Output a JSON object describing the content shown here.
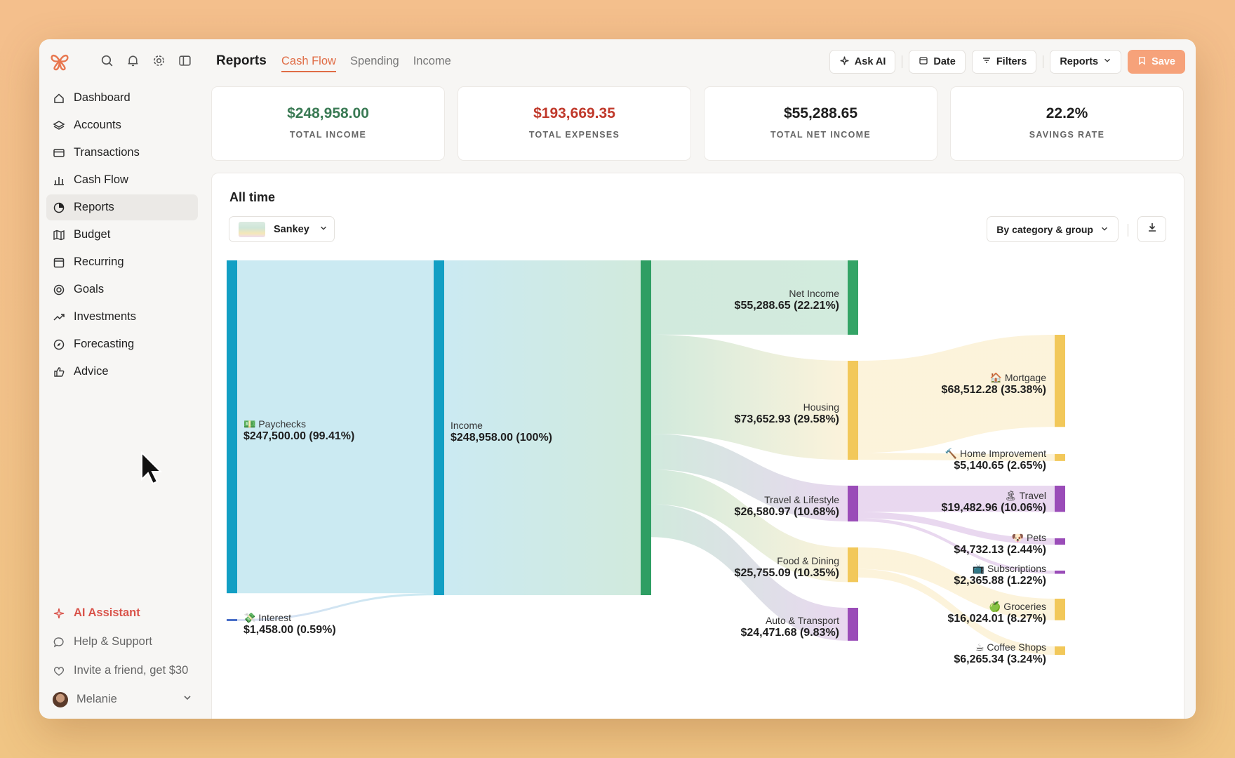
{
  "sidebar": {
    "nav": [
      {
        "label": "Dashboard",
        "icon": "home-icon"
      },
      {
        "label": "Accounts",
        "icon": "layers-icon"
      },
      {
        "label": "Transactions",
        "icon": "card-icon"
      },
      {
        "label": "Cash Flow",
        "icon": "bar-chart-icon"
      },
      {
        "label": "Reports",
        "icon": "pie-chart-icon",
        "active": true
      },
      {
        "label": "Budget",
        "icon": "map-icon"
      },
      {
        "label": "Recurring",
        "icon": "calendar-icon"
      },
      {
        "label": "Goals",
        "icon": "target-icon"
      },
      {
        "label": "Investments",
        "icon": "trend-icon"
      },
      {
        "label": "Forecasting",
        "icon": "compass-icon"
      },
      {
        "label": "Advice",
        "icon": "thumbs-up-icon"
      }
    ],
    "ai_assistant": "AI Assistant",
    "help": "Help & Support",
    "invite": "Invite a friend, get $30",
    "user": "Melanie"
  },
  "header": {
    "title": "Reports",
    "tabs": [
      "Cash Flow",
      "Spending",
      "Income"
    ],
    "active_tab": "Cash Flow",
    "ask_ai": "Ask AI",
    "date": "Date",
    "filters": "Filters",
    "reports": "Reports",
    "save": "Save"
  },
  "stats": [
    {
      "value": "$248,958.00",
      "label": "TOTAL INCOME",
      "color": "#3a7a54"
    },
    {
      "value": "$193,669.35",
      "label": "TOTAL EXPENSES",
      "color": "#c0392b"
    },
    {
      "value": "$55,288.65",
      "label": "TOTAL NET INCOME",
      "color": "#1e1e1e"
    },
    {
      "value": "22.2%",
      "label": "SAVINGS RATE",
      "color": "#1e1e1e"
    }
  ],
  "card": {
    "title": "All time",
    "chart_type_select": "Sankey",
    "group_select": "By category & group"
  },
  "chart_data": {
    "type": "sankey",
    "nodes": [
      {
        "id": "paychecks",
        "name": "💵 Paychecks",
        "value": 247500.0,
        "label": "$247,500.00 (99.41%)",
        "color": "#129fc4"
      },
      {
        "id": "interest",
        "name": "💸 Interest",
        "value": 1458.0,
        "label": "$1,458.00 (0.59%)",
        "color": "#4a6fc8"
      },
      {
        "id": "income",
        "name": "Income",
        "value": 248958.0,
        "label": "$248,958.00 (100%)",
        "color": "#129fc4"
      },
      {
        "id": "total",
        "name": "",
        "value": 248958.0,
        "color": "#2e9e63"
      },
      {
        "id": "net",
        "name": "Net Income",
        "value": 55288.65,
        "label": "$55,288.65 (22.21%)",
        "color": "#34a466"
      },
      {
        "id": "housing",
        "name": "Housing",
        "value": 73652.93,
        "label": "$73,652.93 (29.58%)",
        "color": "#f2c85a"
      },
      {
        "id": "travel_life",
        "name": "Travel & Lifestyle",
        "value": 26580.97,
        "label": "$26,580.97 (10.68%)",
        "color": "#9a4cb8"
      },
      {
        "id": "food",
        "name": "Food & Dining",
        "value": 25755.09,
        "label": "$25,755.09 (10.35%)",
        "color": "#f2c85a"
      },
      {
        "id": "auto",
        "name": "Auto & Transport",
        "value": 24471.68,
        "label": "$24,471.68 (9.83%)",
        "color": "#9a4cb8"
      },
      {
        "id": "mortgage",
        "name": "🏠 Mortgage",
        "value": 68512.28,
        "label": "$68,512.28 (35.38%)",
        "color": "#f2c85a"
      },
      {
        "id": "home_imp",
        "name": "🔨 Home Improvement",
        "value": 5140.65,
        "label": "$5,140.65 (2.65%)",
        "color": "#f2c85a"
      },
      {
        "id": "travel",
        "name": "🏝 Travel",
        "value": 19482.96,
        "label": "$19,482.96 (10.06%)",
        "color": "#9a4cb8"
      },
      {
        "id": "pets",
        "name": "🐶 Pets",
        "value": 4732.13,
        "label": "$4,732.13 (2.44%)",
        "color": "#9a4cb8"
      },
      {
        "id": "subs",
        "name": "📺 Subscriptions",
        "value": 2365.88,
        "label": "$2,365.88 (1.22%)",
        "color": "#9a4cb8"
      },
      {
        "id": "groceries",
        "name": "🍏 Groceries",
        "value": 16024.01,
        "label": "$16,024.01 (8.27%)",
        "color": "#f2c85a"
      },
      {
        "id": "coffee",
        "name": "☕ Coffee Shops",
        "value": 6265.34,
        "label": "$6,265.34 (3.24%)",
        "color": "#f2c85a"
      }
    ],
    "links": [
      {
        "source": "paychecks",
        "target": "income",
        "value": 247500.0
      },
      {
        "source": "interest",
        "target": "income",
        "value": 1458.0
      },
      {
        "source": "income",
        "target": "total",
        "value": 248958.0
      },
      {
        "source": "total",
        "target": "net",
        "value": 55288.65
      },
      {
        "source": "total",
        "target": "housing",
        "value": 73652.93
      },
      {
        "source": "total",
        "target": "travel_life",
        "value": 26580.97
      },
      {
        "source": "total",
        "target": "food",
        "value": 25755.09
      },
      {
        "source": "total",
        "target": "auto",
        "value": 24471.68
      },
      {
        "source": "housing",
        "target": "mortgage",
        "value": 68512.28
      },
      {
        "source": "housing",
        "target": "home_imp",
        "value": 5140.65
      },
      {
        "source": "travel_life",
        "target": "travel",
        "value": 19482.96
      },
      {
        "source": "travel_life",
        "target": "pets",
        "value": 4732.13
      },
      {
        "source": "travel_life",
        "target": "subs",
        "value": 2365.88
      },
      {
        "source": "food",
        "target": "groceries",
        "value": 16024.01
      },
      {
        "source": "food",
        "target": "coffee",
        "value": 6265.34
      }
    ]
  }
}
